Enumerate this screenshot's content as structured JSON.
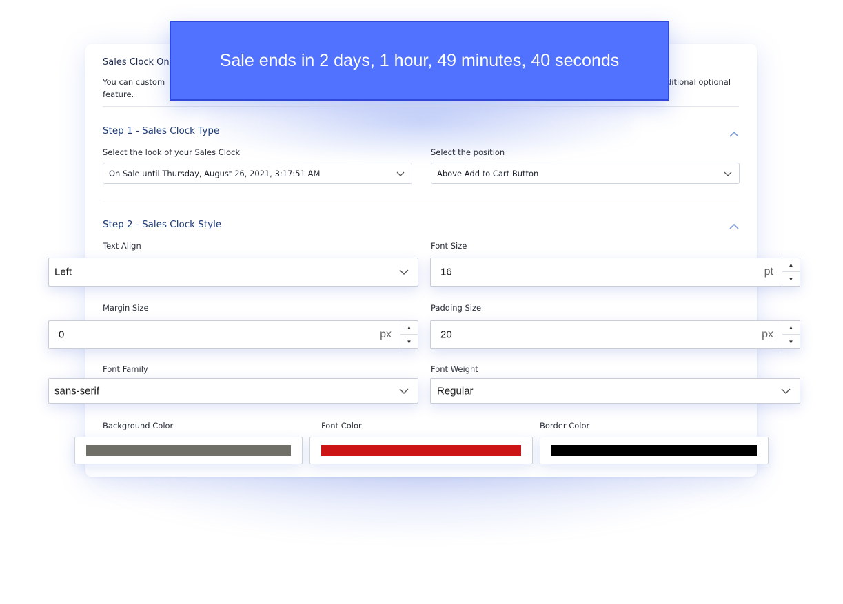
{
  "banner": {
    "text": "Sale ends in 2 days, 1 hour, 49 minutes, 40 seconds",
    "color": "#5172ff"
  },
  "intro": {
    "title": "Sales Clock On",
    "text_start": "You can custom",
    "text_end": "ditional optional",
    "text_line2": "feature."
  },
  "step1": {
    "title": "Step 1 - Sales Clock Type",
    "look_label": "Select the look of your Sales Clock",
    "look_value": "On Sale until Thursday, August 26, 2021, 3:17:51 AM",
    "position_label": "Select the position",
    "position_value": "Above Add to Cart Button"
  },
  "step2": {
    "title": "Step 2 - Sales Clock Style",
    "text_align": {
      "label": "Text Align",
      "value": "Left"
    },
    "font_size": {
      "label": "Font Size",
      "value": "16",
      "unit": "pt"
    },
    "margin_size": {
      "label": "Margin Size",
      "value": "0",
      "unit": "px"
    },
    "padding_size": {
      "label": "Padding Size",
      "value": "20",
      "unit": "px"
    },
    "font_family": {
      "label": "Font Family",
      "value": "sans-serif"
    },
    "font_weight": {
      "label": "Font Weight",
      "value": "Regular"
    },
    "background_color": {
      "label": "Background Color",
      "color": "#6f6f67"
    },
    "font_color": {
      "label": "Font Color",
      "color": "#cc1417"
    },
    "border_color": {
      "label": "Border Color",
      "color": "#000000"
    }
  },
  "icons": {
    "collapse": "chevron-up-icon",
    "dropdown": "chevron-down-icon",
    "increment": "triangle-up-icon",
    "decrement": "triangle-down-icon"
  }
}
